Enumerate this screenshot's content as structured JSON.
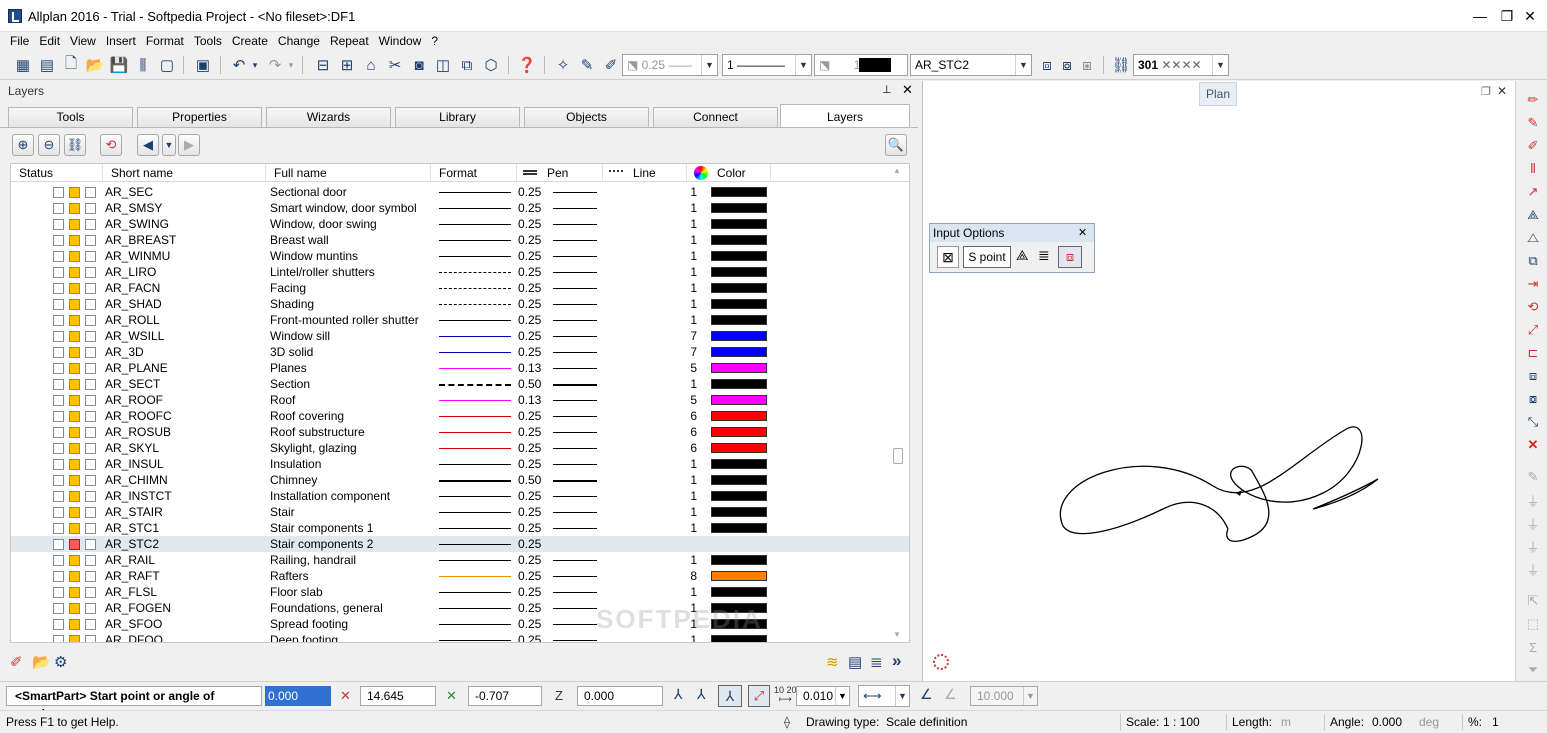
{
  "window": {
    "title": "Allplan 2016 - Trial - Softpedia Project - <No fileset>:DF1",
    "minimize": "—",
    "restore": "❐",
    "close": "✕"
  },
  "menu": [
    "File",
    "Edit",
    "View",
    "Insert",
    "Format",
    "Tools",
    "Create",
    "Change",
    "Repeat",
    "Window",
    "?"
  ],
  "toolbar": {
    "pen_value": "0.25",
    "line_value": "1",
    "color_value": "1",
    "layer_value": "AR_STC2",
    "hatch_value": "301"
  },
  "panel": {
    "title": "Layers",
    "pin": "📌",
    "close": "✕",
    "tabs": [
      "Tools",
      "Properties",
      "Wizards",
      "Library",
      "Objects",
      "Connect",
      "Layers"
    ],
    "active_tab": "Layers"
  },
  "grid": {
    "headers": {
      "status": "Status",
      "short": "Short name",
      "full": "Full name",
      "format": "Format",
      "pen": "Pen",
      "line": "Line",
      "color": "Color"
    },
    "rows": [
      {
        "short": "AR_SEC",
        "full": "Sectional door",
        "pen": "0.25",
        "line": "1",
        "color": "#000000",
        "style": "solid",
        "fcolor": "#000000",
        "st": "y"
      },
      {
        "short": "AR_SMSY",
        "full": "Smart window, door symbol",
        "pen": "0.25",
        "line": "1",
        "color": "#000000",
        "style": "solid",
        "fcolor": "#000000",
        "st": "y"
      },
      {
        "short": "AR_SWING",
        "full": "Window, door swing",
        "pen": "0.25",
        "line": "1",
        "color": "#000000",
        "style": "solid",
        "fcolor": "#000000",
        "st": "y"
      },
      {
        "short": "AR_BREAST",
        "full": "Breast wall",
        "pen": "0.25",
        "line": "1",
        "color": "#000000",
        "style": "solid",
        "fcolor": "#000000",
        "st": "y"
      },
      {
        "short": "AR_WINMU",
        "full": "Window muntins",
        "pen": "0.25",
        "line": "1",
        "color": "#000000",
        "style": "solid",
        "fcolor": "#000000",
        "st": "y"
      },
      {
        "short": "AR_LIRO",
        "full": "Lintel/roller shutters",
        "pen": "0.25",
        "line": "1",
        "color": "#000000",
        "style": "dashed",
        "fcolor": "#000000",
        "st": "y"
      },
      {
        "short": "AR_FACN",
        "full": "Facing",
        "pen": "0.25",
        "line": "1",
        "color": "#000000",
        "style": "dashed",
        "fcolor": "#000000",
        "st": "y"
      },
      {
        "short": "AR_SHAD",
        "full": "Shading",
        "pen": "0.25",
        "line": "1",
        "color": "#000000",
        "style": "dashed",
        "fcolor": "#000000",
        "st": "y"
      },
      {
        "short": "AR_ROLL",
        "full": "Front-mounted roller shutter",
        "pen": "0.25",
        "line": "1",
        "color": "#000000",
        "style": "solid",
        "fcolor": "#000000",
        "st": "y"
      },
      {
        "short": "AR_WSILL",
        "full": "Window sill",
        "pen": "0.25",
        "line": "7",
        "color": "#0000ff",
        "style": "solid",
        "fcolor": "#0000aa",
        "st": "y"
      },
      {
        "short": "AR_3D",
        "full": "3D solid",
        "pen": "0.25",
        "line": "7",
        "color": "#0000ff",
        "style": "solid",
        "fcolor": "#0000aa",
        "st": "y"
      },
      {
        "short": "AR_PLANE",
        "full": "Planes",
        "pen": "0.13",
        "line": "5",
        "color": "#ff00ff",
        "style": "solid",
        "fcolor": "#ff00ff",
        "st": "y"
      },
      {
        "short": "AR_SECT",
        "full": "Section",
        "pen": "0.50",
        "line": "1",
        "color": "#000000",
        "style": "dashdot",
        "fcolor": "#000000",
        "st": "y"
      },
      {
        "short": "AR_ROOF",
        "full": "Roof",
        "pen": "0.13",
        "line": "5",
        "color": "#ff00ff",
        "style": "solid",
        "fcolor": "#ff00ff",
        "st": "y"
      },
      {
        "short": "AR_ROOFC",
        "full": "Roof covering",
        "pen": "0.25",
        "line": "6",
        "color": "#ff0000",
        "style": "solid",
        "fcolor": "#dd0000",
        "st": "y"
      },
      {
        "short": "AR_ROSUB",
        "full": "Roof substructure",
        "pen": "0.25",
        "line": "6",
        "color": "#ff0000",
        "style": "solid",
        "fcolor": "#dd0000",
        "st": "y"
      },
      {
        "short": "AR_SKYL",
        "full": "Skylight, glazing",
        "pen": "0.25",
        "line": "6",
        "color": "#ff0000",
        "style": "solid",
        "fcolor": "#dd0000",
        "st": "y"
      },
      {
        "short": "AR_INSUL",
        "full": "Insulation",
        "pen": "0.25",
        "line": "1",
        "color": "#000000",
        "style": "solid",
        "fcolor": "#000000",
        "st": "y"
      },
      {
        "short": "AR_CHIMN",
        "full": "Chimney",
        "pen": "0.50",
        "line": "1",
        "color": "#000000",
        "style": "thick",
        "fcolor": "#000000",
        "st": "y"
      },
      {
        "short": "AR_INSTCT",
        "full": "Installation component",
        "pen": "0.25",
        "line": "1",
        "color": "#000000",
        "style": "solid",
        "fcolor": "#000000",
        "st": "y"
      },
      {
        "short": "AR_STAIR",
        "full": "Stair",
        "pen": "0.25",
        "line": "1",
        "color": "#000000",
        "style": "solid",
        "fcolor": "#000000",
        "st": "y"
      },
      {
        "short": "AR_STC1",
        "full": "Stair components 1",
        "pen": "0.25",
        "line": "1",
        "color": "#000000",
        "style": "solid",
        "fcolor": "#000000",
        "st": "y"
      },
      {
        "short": "AR_STC2",
        "full": "Stair components 2",
        "pen": "0.25",
        "line": "",
        "color": "",
        "style": "solid",
        "fcolor": "#000000",
        "st": "r",
        "selected": true
      },
      {
        "short": "AR_RAIL",
        "full": "Railing, handrail",
        "pen": "0.25",
        "line": "1",
        "color": "#000000",
        "style": "solid",
        "fcolor": "#000000",
        "st": "y"
      },
      {
        "short": "AR_RAFT",
        "full": "Rafters",
        "pen": "0.25",
        "line": "8",
        "color": "#ff7f00",
        "style": "solid",
        "fcolor": "#e69500",
        "st": "y"
      },
      {
        "short": "AR_FLSL",
        "full": "Floor slab",
        "pen": "0.25",
        "line": "1",
        "color": "#000000",
        "style": "solid",
        "fcolor": "#000000",
        "st": "y"
      },
      {
        "short": "AR_FOGEN",
        "full": "Foundations, general",
        "pen": "0.25",
        "line": "1",
        "color": "#000000",
        "style": "solid",
        "fcolor": "#000000",
        "st": "y"
      },
      {
        "short": "AR_SFOO",
        "full": "Spread footing",
        "pen": "0.25",
        "line": "1",
        "color": "#000000",
        "style": "solid",
        "fcolor": "#000000",
        "st": "y"
      },
      {
        "short": "AR_DFOO",
        "full": "Deep footing",
        "pen": "0.25",
        "line": "1",
        "color": "#000000",
        "style": "solid",
        "fcolor": "#000000",
        "st": "y"
      }
    ]
  },
  "watermark": "SOFTPEDIA",
  "view": {
    "label": "Plan"
  },
  "input_options": {
    "title": "Input Options",
    "spoint": "S point",
    "close": "✕"
  },
  "command": {
    "prompt": "<SmartPart> Start point or angle of rotation",
    "angle": "0.000",
    "x": "14.645",
    "y": "-0.707",
    "z": "0.000",
    "grid": "0.010",
    "dim": "10.000"
  },
  "status": {
    "help": "Press F1 to get Help.",
    "drawing_label": "Drawing type:",
    "drawing_value": "Scale definition",
    "scale_label": "Scale:",
    "scale_value": "1 : 100",
    "length_label": "Length:",
    "length_unit": "m",
    "angle_label": "Angle:",
    "angle_value": "0.000",
    "angle_unit": "deg",
    "pct_label": "%:",
    "pct_value": "1"
  }
}
